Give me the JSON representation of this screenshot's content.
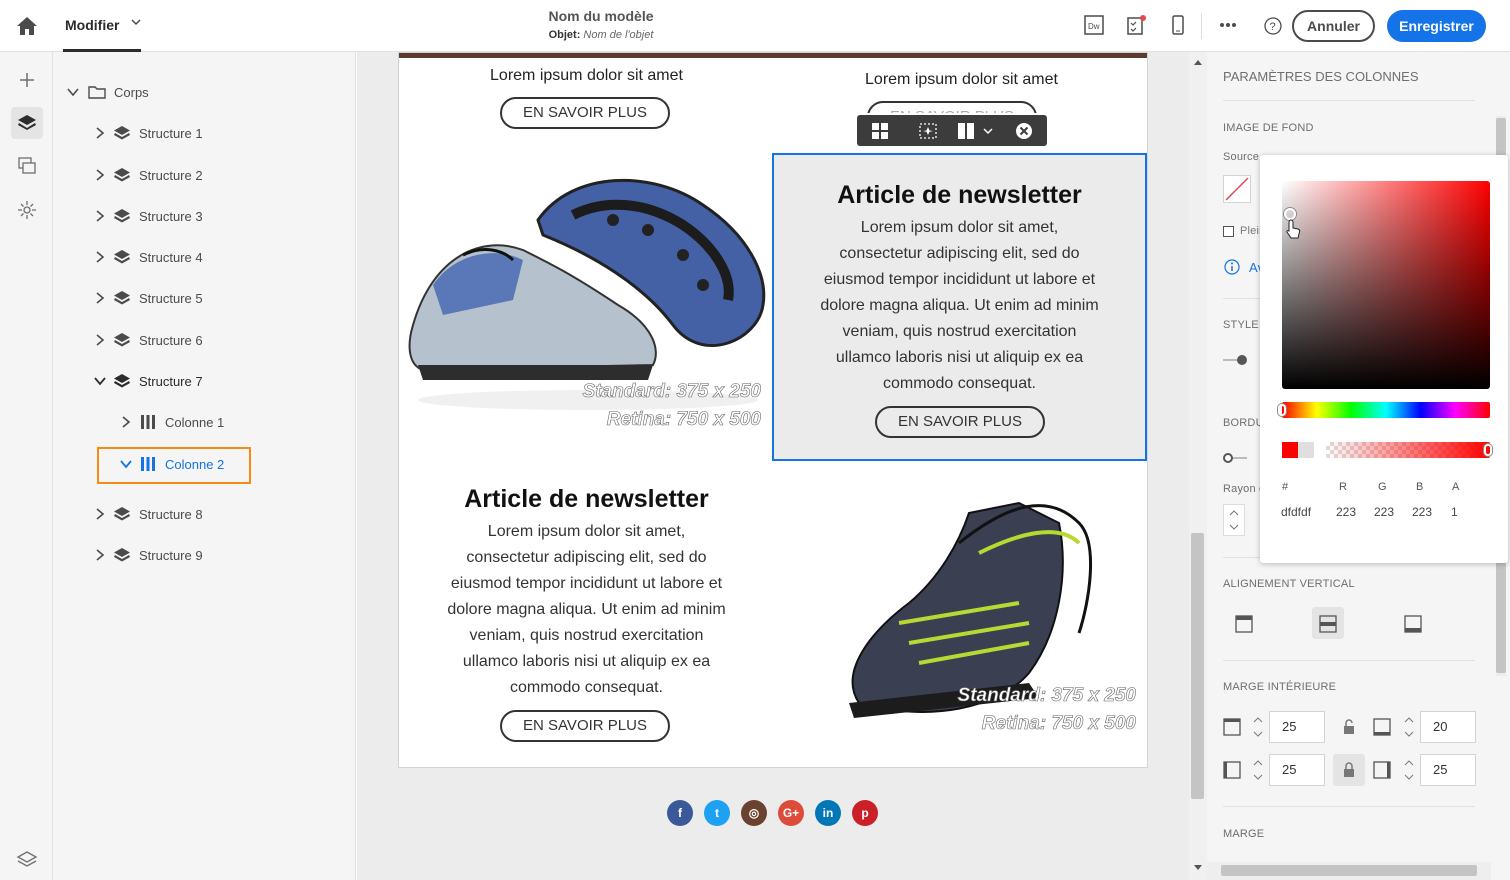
{
  "topbar": {
    "modifier_label": "Modifier",
    "title": "Nom du modèle",
    "subject_label": "Objet:",
    "subject_placeholder": "Nom de l'objet",
    "cancel_label": "Annuler",
    "save_label": "Enregistrer"
  },
  "tree": {
    "root": "Corps",
    "items": [
      {
        "label": "Structure 1"
      },
      {
        "label": "Structure 2"
      },
      {
        "label": "Structure 3"
      },
      {
        "label": "Structure 4"
      },
      {
        "label": "Structure 5"
      },
      {
        "label": "Structure 6"
      },
      {
        "label": "Structure 7"
      },
      {
        "label": "Colonne 1"
      },
      {
        "label": "Colonne 2"
      },
      {
        "label": "Structure 8"
      },
      {
        "label": "Structure 9"
      }
    ]
  },
  "email": {
    "top_left_text": "Lorem ipsum dolor sit amet",
    "top_right_text": "Lorem ipsum dolor sit amet",
    "top_right_btn_partial": "EN SAVOIR PLUS",
    "btn_label": "EN SAVOIR PLUS",
    "article_title": "Article de newsletter",
    "article_lines": [
      "Lorem ipsum dolor sit amet,",
      "consectetur adipiscing elit, sed do",
      "eiusmod tempor incididunt ut labore et",
      "dolore magna aliqua. Ut enim ad minim",
      "veniam, quis nostrud exercitation",
      "ullamco laboris nisi ut aliquip ex ea",
      "commodo consequat."
    ],
    "img_label_1": "Standard: 375 x 250",
    "img_label_2": "Retina: 750 x 500"
  },
  "social": [
    {
      "name": "facebook",
      "color": "#3b5998"
    },
    {
      "name": "twitter",
      "color": "#1da1f2"
    },
    {
      "name": "instagram",
      "color": "#6b4130"
    },
    {
      "name": "google-plus",
      "color": "#dd4b39"
    },
    {
      "name": "linkedin",
      "color": "#0077b5"
    },
    {
      "name": "pinterest",
      "color": "#cb2027"
    }
  ],
  "panel": {
    "title": "PARAMÈTRES DES COLONNES",
    "bg_image": "IMAGE DE FOND",
    "source": "Source",
    "plein": "Plein",
    "link": "Av",
    "style": "STYLE",
    "border": "BORDU",
    "radius": "Rayon c",
    "valign": "ALIGNEMENT VERTICAL",
    "padding": "MARGE INTÉRIEURE",
    "margin": "MARGE",
    "pad_top": "25",
    "pad_bottom": "20",
    "pad_left": "25",
    "pad_right": "25"
  },
  "picker": {
    "hex_label": "#",
    "r_label": "R",
    "g_label": "G",
    "b_label": "B",
    "a_label": "A",
    "hex": "dfdfdf",
    "r": "223",
    "g": "223",
    "b": "223",
    "a": "1"
  }
}
